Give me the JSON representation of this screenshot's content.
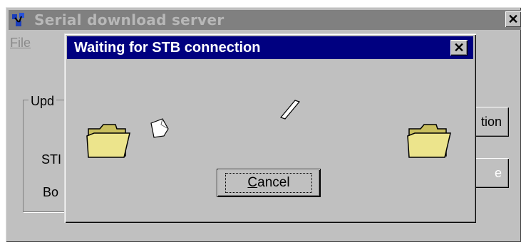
{
  "main_window": {
    "title": "Serial download server",
    "close_glyph": "✕",
    "menu": {
      "file": "File"
    },
    "group": {
      "label": "Upd",
      "field1": "STI",
      "field2": "Bo"
    },
    "buttons": {
      "right1": "tion",
      "right2": "e"
    }
  },
  "dialog": {
    "title": "Waiting for STB connection",
    "close_glyph": "✕",
    "cancel": {
      "accel": "C",
      "rest": "ancel"
    }
  },
  "icons": {
    "app": "network-app-icon",
    "source_folder": "folder-icon",
    "dest_folder": "folder-icon",
    "flying_doc": "document-icon"
  },
  "colors": {
    "dialog_titlebar": "#000080",
    "face": "#c0c0c0",
    "inactive_titlebar": "#808080",
    "folder": "#e9e08a"
  }
}
